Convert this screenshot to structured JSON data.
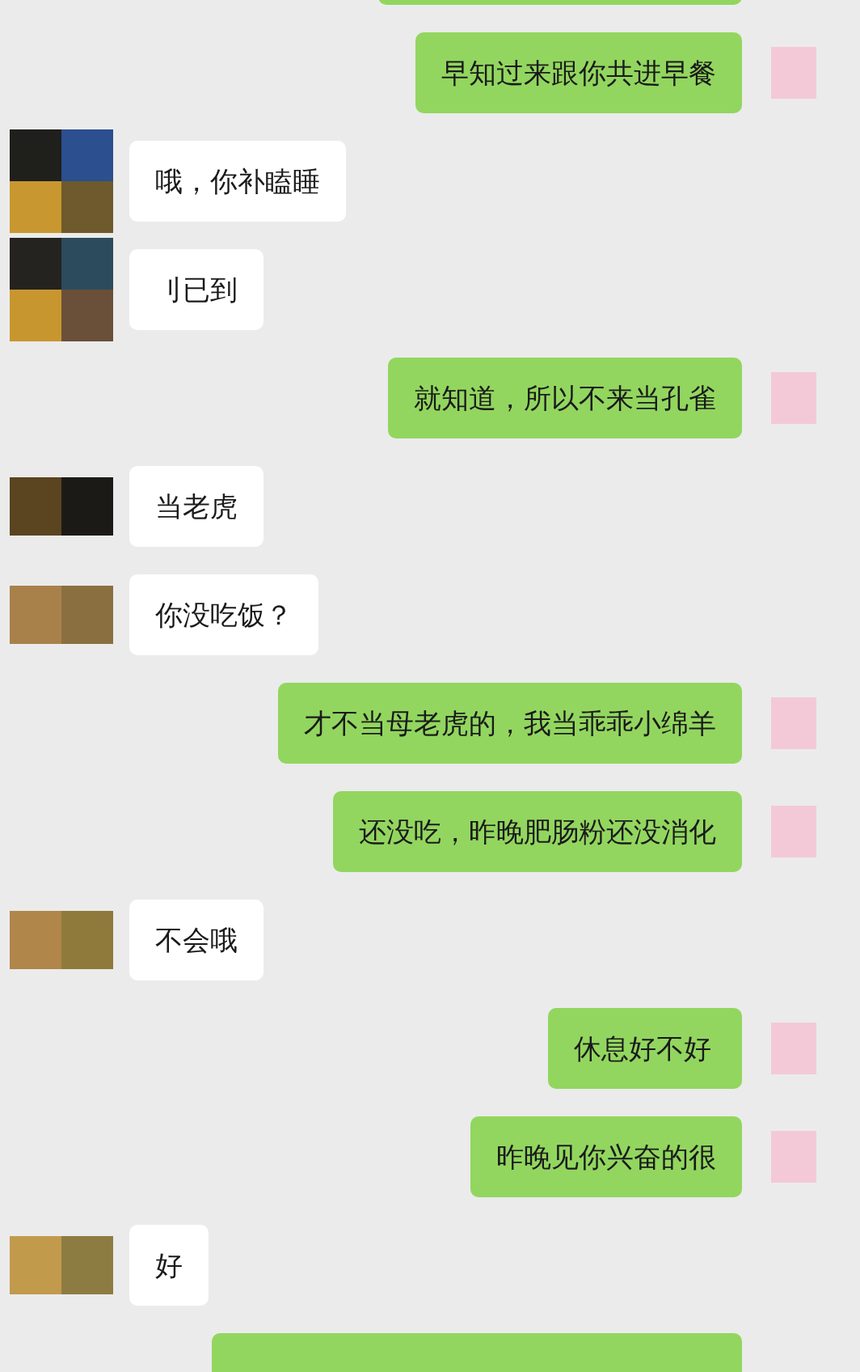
{
  "messages": [
    {
      "kind": "outgoing"
    },
    {
      "kind": "outgoing",
      "text": "早知过来跟你共进早餐"
    },
    {
      "kind": "incoming",
      "text": "哦，你补瞌睡"
    },
    {
      "kind": "incoming",
      "text": "刂已到"
    },
    {
      "kind": "outgoing",
      "text": "就知道，所以不来当孔雀"
    },
    {
      "kind": "incoming",
      "text": "当老虎"
    },
    {
      "kind": "incoming",
      "text": "你没吃饭？"
    },
    {
      "kind": "outgoing",
      "text": "才不当母老虎的，我当乖乖小绵羊"
    },
    {
      "kind": "outgoing",
      "text": "还没吃，昨晚肥肠粉还没消化"
    },
    {
      "kind": "incoming",
      "text": "不会哦"
    },
    {
      "kind": "outgoing",
      "text": "休息好不好"
    },
    {
      "kind": "outgoing",
      "text": "昨晚见你兴奋的很"
    },
    {
      "kind": "incoming",
      "text": "好"
    },
    {
      "kind": "outgoing"
    }
  ]
}
